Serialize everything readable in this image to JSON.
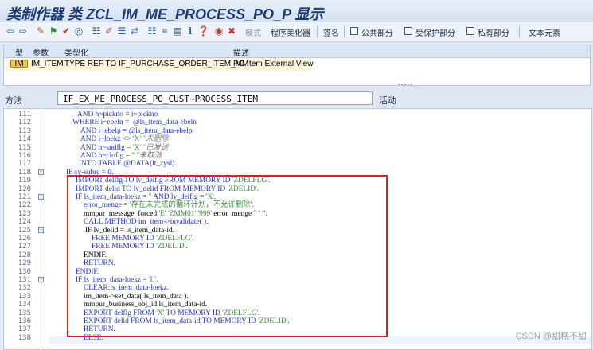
{
  "window": {
    "title": "类制作器 类 ZCL_IM_ME_PROCESS_PO_P 显示"
  },
  "toolbar": {
    "icons": [
      "back-icon",
      "forward-icon",
      "display-change-icon",
      "activate-icon",
      "check-icon",
      "object-list-icon",
      "hierarchy-icon",
      "edit-icon",
      "where-used-icon",
      "navigate-icon",
      "layout-icon",
      "tree-icon",
      "info-icon",
      "help-icon",
      "test-icon",
      "delete-icon"
    ],
    "mode_label": "模式",
    "pretty_printer_label": "程序美化器",
    "signature_label": "签名",
    "public_section_label": "公共部分",
    "protected_section_label": "受保护部分",
    "private_section_label": "私有部分",
    "text_elements_label": "文本元素"
  },
  "params": {
    "headers": {
      "type": "型",
      "param": "参数",
      "typing": "类型化",
      "description": "描述"
    },
    "rows": [
      {
        "badge": "IM",
        "name": "IM_ITEM",
        "typing": "TYPE REF TO IF_PURCHASE_ORDER_ITEM_MM",
        "description": "PO Item External View"
      }
    ]
  },
  "method": {
    "label": "方法",
    "name": "IF_EX_ME_PROCESS_PO_CUST~PROCESS_ITEM",
    "state": "活动"
  },
  "code": [
    {
      "n": "111",
      "parts": [
        [
          "AND h~pickno = i~pickno",
          "kw"
        ]
      ]
    },
    {
      "n": "112",
      "parts": [
        [
          "WHERE i~ebeln =  @ls_item_data-ebeln",
          "kw"
        ]
      ]
    },
    {
      "n": "113",
      "parts": [
        [
          "AND i~ebelp = @ls_item_data-ebelp",
          "kw"
        ]
      ]
    },
    {
      "n": "114",
      "parts": [
        [
          "AND i~loekz <> ",
          "kw"
        ],
        [
          "'X' ",
          "str"
        ],
        [
          "\"未删除",
          "cmt"
        ]
      ]
    },
    {
      "n": "115",
      "parts": [
        [
          "AND h~sndflg = ",
          "kw"
        ],
        [
          "'X' ",
          "str"
        ],
        [
          "\"已发送",
          "cmt"
        ]
      ]
    },
    {
      "n": "116",
      "parts": [
        [
          "AND h~cloflg = ",
          "kw"
        ],
        [
          "'' ",
          "str"
        ],
        [
          "\"未取消",
          "cmt"
        ]
      ]
    },
    {
      "n": "117",
      "parts": [
        [
          "INTO TABLE @DATA(lt_zysl).",
          "kw"
        ]
      ]
    },
    {
      "n": "118",
      "parts": [
        [
          "IF sy-subrc = 0.",
          "kw"
        ]
      ]
    },
    {
      "n": "119",
      "parts": [
        [
          "IMPORT delflg TO lv_delflg FROM MEMORY ID ",
          "kw"
        ],
        [
          "'ZDELFLG'",
          "str"
        ],
        [
          ".",
          "kw"
        ]
      ]
    },
    {
      "n": "120",
      "parts": [
        [
          "IMPORT delid TO lv_delid FROM MEMORY ID ",
          "kw"
        ],
        [
          "'ZDELID'",
          "str"
        ],
        [
          ".",
          "kw"
        ]
      ]
    },
    {
      "n": "121",
      "parts": [
        [
          "IF ls_item_data-loekz = ",
          "kw"
        ],
        [
          "''",
          "str"
        ],
        [
          " AND lv_delflg = ",
          "kw"
        ],
        [
          "'X'",
          "str"
        ],
        [
          ".",
          "kw"
        ]
      ]
    },
    {
      "n": "122",
      "parts": [
        [
          "error_menge = ",
          "kw"
        ],
        [
          "'存在未完成的循环计划，不允许删除'",
          "str"
        ],
        [
          ".",
          "kw"
        ]
      ]
    },
    {
      "n": "123",
      "parts": [
        [
          "mmpur_message_forced ",
          "txt"
        ],
        [
          "'E' 'ZMM01' '999'",
          "str"
        ],
        [
          " error_menge ",
          "txt"
        ],
        [
          "'' '' ''",
          "str"
        ],
        [
          ".",
          "kw"
        ]
      ]
    },
    {
      "n": "124",
      "parts": [
        [
          "CALL METHOD im_item->invalidate( ).",
          "kw"
        ]
      ]
    },
    {
      "n": "125",
      "parts": [
        [
          "IF lv_delid = ls_item_data-id.",
          "txt"
        ]
      ]
    },
    {
      "n": "126",
      "parts": [
        [
          "FREE MEMORY ID ",
          "kw"
        ],
        [
          "'ZDELFLG'",
          "str"
        ],
        [
          ".",
          "kw"
        ]
      ]
    },
    {
      "n": "127",
      "parts": [
        [
          "FREE MEMORY ID ",
          "kw"
        ],
        [
          "'ZDELID'",
          "str"
        ],
        [
          ".",
          "kw"
        ]
      ]
    },
    {
      "n": "128",
      "parts": [
        [
          "ENDIF.",
          "txt"
        ]
      ]
    },
    {
      "n": "129",
      "parts": [
        [
          "RETURN.",
          "kw"
        ]
      ]
    },
    {
      "n": "130",
      "parts": [
        [
          "ENDIF.",
          "kw"
        ]
      ]
    },
    {
      "n": "131",
      "parts": [
        [
          "IF ls_item_data-loekz = ",
          "kw"
        ],
        [
          "'L'",
          "str"
        ],
        [
          ".",
          "kw"
        ]
      ]
    },
    {
      "n": "132",
      "parts": [
        [
          "CLEAR:ls_item_data-loekz.",
          "kw"
        ]
      ]
    },
    {
      "n": "133",
      "parts": [
        [
          "im_item->set_data( ls_item_data ).",
          "txt"
        ]
      ]
    },
    {
      "n": "134",
      "parts": [
        [
          "mmpur_business_obj_id ls_item_data-id.",
          "txt"
        ]
      ]
    },
    {
      "n": "135",
      "parts": [
        [
          "EXPORT delflg FROM ",
          "kw"
        ],
        [
          "'X'",
          "str"
        ],
        [
          " TO MEMORY ID ",
          "kw"
        ],
        [
          "'ZDELFLG'",
          "str"
        ],
        [
          ".",
          "kw"
        ]
      ]
    },
    {
      "n": "136",
      "parts": [
        [
          "EXPORT delid FROM ls_item_data-id TO MEMORY ID ",
          "kw"
        ],
        [
          "'ZDELID'",
          "str"
        ],
        [
          ".",
          "kw"
        ]
      ]
    },
    {
      "n": "137",
      "parts": [
        [
          "RETURN.",
          "kw"
        ]
      ]
    },
    {
      "n": "138",
      "parts": [
        [
          "ELSE.",
          "kw"
        ]
      ]
    }
  ],
  "watermark": "CSDN @甜糕不甜"
}
